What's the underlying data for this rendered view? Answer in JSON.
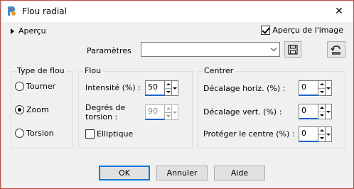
{
  "window": {
    "title": "Flou radial"
  },
  "preview_toggle": {
    "label": "Aperçu"
  },
  "preview_checkbox": {
    "label": "Aperçu de l'image",
    "checked": true
  },
  "presets": {
    "label": "Paramètres",
    "value": ""
  },
  "blur_type": {
    "title": "Type de flou",
    "options": [
      {
        "label": "Tourner",
        "checked": false
      },
      {
        "label": "Zoom",
        "checked": true
      },
      {
        "label": "Torsion",
        "checked": false
      }
    ]
  },
  "blur": {
    "title": "Flou",
    "intensity_label": "Intensité (%) :",
    "intensity_value": "50",
    "torsion_label_1": "Degrés de",
    "torsion_label_2": "torsion :",
    "torsion_value": "90",
    "elliptic_label": "Elliptique",
    "elliptic_checked": false
  },
  "center": {
    "title": "Centrer",
    "h_offset_label": "Décalage horiz. (%) :",
    "h_offset_value": "0",
    "v_offset_label": "Décalage vert. (%) :",
    "v_offset_value": "0",
    "protect_label": "Protéger le centre (%) :",
    "protect_value": "0"
  },
  "buttons": {
    "ok": "OK",
    "cancel": "Annuler",
    "help": "Aide"
  },
  "colors": {
    "accent": "#0078d7",
    "frame": "#c4463f",
    "field_underline": "#1e63c8"
  }
}
